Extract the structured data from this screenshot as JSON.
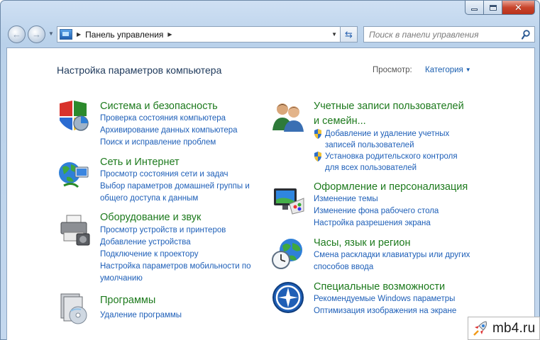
{
  "window": {
    "caption_buttons": [
      "minimize",
      "maximize",
      "close"
    ]
  },
  "nav": {
    "back_icon": "back-arrow-icon",
    "forward_icon": "forward-arrow-icon"
  },
  "address": {
    "crumb": "Панель управления"
  },
  "search": {
    "placeholder": "Поиск в панели управления"
  },
  "header": {
    "title": "Настройка параметров компьютера",
    "view_by_label": "Просмотр:",
    "view_by_value": "Категория"
  },
  "left": [
    {
      "title": "Система и безопасность",
      "icon": "shield-system-icon",
      "links": [
        "Проверка состояния компьютера",
        "Архивирование данных компьютера",
        "Поиск и исправление проблем"
      ]
    },
    {
      "title": "Сеть и Интернет",
      "icon": "network-globe-icon",
      "links": [
        "Просмотр состояния сети и задач",
        "Выбор параметров домашней группы и",
        "общего доступа к данным"
      ]
    },
    {
      "title": "Оборудование и звук",
      "icon": "printer-hardware-icon",
      "links": [
        "Просмотр устройств и принтеров",
        "Добавление устройства",
        "Подключение к проектору",
        "Настройка параметров мобильности по",
        "умолчанию"
      ]
    },
    {
      "title": "Программы",
      "icon": "programs-disc-icon",
      "links": [
        "Удаление программы"
      ]
    }
  ],
  "right": [
    {
      "title_line1": "Учетные записи пользователей",
      "title_line2": "и семейн...",
      "icon": "users-icon",
      "links": [
        "Добавление и удаление учетных",
        "записей пользователей",
        "Установка родительского контроля",
        "для всех пользователей"
      ]
    },
    {
      "title": "Оформление и персонализация",
      "icon": "appearance-monitor-icon",
      "links": [
        "Изменение темы",
        "Изменение фона рабочего стола",
        "Настройка разрешения экрана"
      ]
    },
    {
      "title": "Часы, язык и регион",
      "icon": "clock-globe-icon",
      "links": [
        "Смена раскладки клавиатуры или других",
        "способов ввода"
      ]
    },
    {
      "title": "Специальные возможности",
      "icon": "accessibility-icon",
      "links": [
        "Рекомендуемые Windows параметры",
        "Оптимизация изображения на экране"
      ]
    }
  ],
  "watermark": {
    "text": "mb4.ru",
    "icon": "rocket-icon"
  },
  "colors": {
    "link": "#1e5fb8",
    "category_title": "#1d7a1d",
    "title": "#1e395b"
  }
}
